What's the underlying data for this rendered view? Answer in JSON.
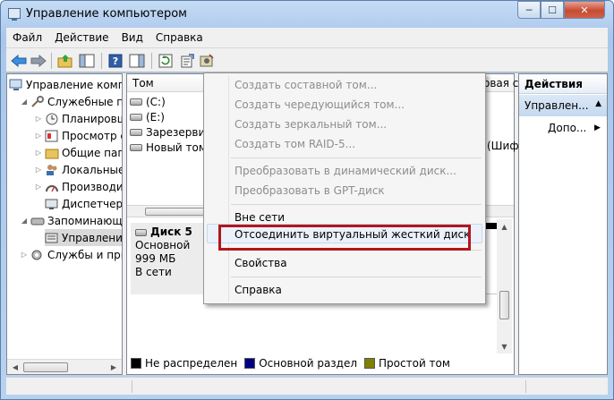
{
  "window": {
    "title": "Управление компьютером",
    "min_glyph": "─",
    "max_glyph": "☐",
    "close_glyph": "✕"
  },
  "menubar": {
    "items": [
      "Файл",
      "Действие",
      "Вид",
      "Справка"
    ]
  },
  "toolbar": {
    "icons": [
      "back-arrow-icon",
      "forward-arrow-icon",
      "up-folder-icon",
      "show-hide-tree-icon",
      "help-icon",
      "properties-panel-icon",
      "refresh-icon",
      "export-list-icon",
      "settings-icon"
    ]
  },
  "tree": {
    "items": [
      {
        "label": "Управление компь",
        "level": 0,
        "expander": "",
        "icon": "computer-icon"
      },
      {
        "label": "Служебные пр",
        "level": 1,
        "expander": "◢",
        "icon": "tools-icon"
      },
      {
        "label": "Планировщ",
        "level": 2,
        "expander": "▷",
        "icon": "clock-icon"
      },
      {
        "label": "Просмотр с",
        "level": 2,
        "expander": "▷",
        "icon": "event-viewer-icon"
      },
      {
        "label": "Общие папк",
        "level": 2,
        "expander": "▷",
        "icon": "shared-folder-icon"
      },
      {
        "label": "Локальные",
        "level": 2,
        "expander": "▷",
        "icon": "users-icon"
      },
      {
        "label": "Производит",
        "level": 2,
        "expander": "▷",
        "icon": "performance-icon"
      },
      {
        "label": "Диспетчер",
        "level": 2,
        "expander": "",
        "icon": "device-manager-icon"
      },
      {
        "label": "Запоминающ",
        "level": 1,
        "expander": "◢",
        "icon": "storage-icon"
      },
      {
        "label": "Управлени",
        "level": 2,
        "expander": "",
        "icon": "disk-management-icon"
      },
      {
        "label": "Службы и при",
        "level": 1,
        "expander": "▷",
        "icon": "services-icon"
      }
    ]
  },
  "volumes": {
    "header_col1": "Том",
    "header_col2": "овая с",
    "rows": [
      {
        "label": "(C:)",
        "extra": ""
      },
      {
        "label": "(E:)",
        "extra": ""
      },
      {
        "label": "Зарезервир",
        "extra": ""
      },
      {
        "label": "Новый том",
        "extra": "(Шиф"
      }
    ]
  },
  "disk": {
    "name": "Диск 5",
    "type": "Основной",
    "size": "999 МБ",
    "status": "В сети"
  },
  "legend": [
    {
      "label": "Не распределен",
      "color": "#000000"
    },
    {
      "label": "Основной раздел",
      "color": "#000080"
    },
    {
      "label": "Простой том",
      "color": "#808000"
    }
  ],
  "actions": {
    "header": "Действия",
    "section": "Управлен...",
    "more": "Допо..."
  },
  "context_menu": {
    "items": [
      {
        "label": "Создать составной том...",
        "disabled": true
      },
      {
        "label": "Создать чередующийся том...",
        "disabled": true
      },
      {
        "label": "Создать зеркальный том...",
        "disabled": true
      },
      {
        "label": "Создать том RAID-5...",
        "disabled": true
      },
      {
        "label": "Преобразовать в динамический диск...",
        "disabled": true
      },
      {
        "label": "Преобразовать в GPT-диск",
        "disabled": true
      },
      {
        "label": "Вне сети",
        "disabled": false
      },
      {
        "label": "Отсоединить виртуальный жесткий диск",
        "disabled": false
      },
      {
        "label": "Свойства",
        "disabled": false
      },
      {
        "label": "Справка",
        "disabled": false
      }
    ]
  },
  "colors": {
    "highlight_frame": "#b3161c"
  }
}
